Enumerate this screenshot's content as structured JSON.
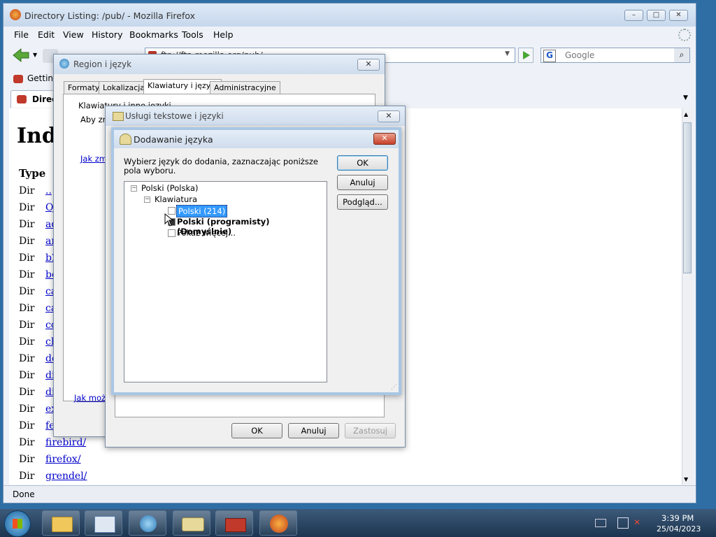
{
  "firefox": {
    "title": "Directory Listing: /pub/ - Mozilla Firefox",
    "menu": [
      "File",
      "Edit",
      "View",
      "History",
      "Bookmarks",
      "Tools",
      "Help"
    ],
    "url": "ftp://ftp.mozilla.org/pub/",
    "search_placeholder": "Google",
    "bookmark": "Getting Started",
    "tab": "Directory Listing: /pub/",
    "heading": "Index of /pub/",
    "column_type": "Type",
    "rows": [
      {
        "type": "Dir",
        "name": ".."
      },
      {
        "type": "Dir",
        "name": "OJI/"
      },
      {
        "type": "Dir",
        "name": "addons/"
      },
      {
        "type": "Dir",
        "name": "artwork/"
      },
      {
        "type": "Dir",
        "name": "b2g/"
      },
      {
        "type": "Dir",
        "name": "bouncer/"
      },
      {
        "type": "Dir",
        "name": "calendar/"
      },
      {
        "type": "Dir",
        "name": "camino/"
      },
      {
        "type": "Dir",
        "name": "composer/"
      },
      {
        "type": "Dir",
        "name": "chat/"
      },
      {
        "type": "Dir",
        "name": "devpreview/"
      },
      {
        "type": "Dir",
        "name": "directory/"
      },
      {
        "type": "Dir",
        "name": "dist/"
      },
      {
        "type": "Dir",
        "name": "extensions/"
      },
      {
        "type": "Dir",
        "name": "fenix/"
      },
      {
        "type": "Dir",
        "name": "firebird/"
      },
      {
        "type": "Dir",
        "name": "firefox/"
      },
      {
        "type": "Dir",
        "name": "grendel/"
      }
    ],
    "status": "Done"
  },
  "region_dialog": {
    "title": "Region i język",
    "tabs": [
      "Formaty",
      "Lokalizacja",
      "Klawiatury i języki",
      "Administracyjne"
    ],
    "group_label": "Klawiatury i inne języki",
    "text": "Aby zmienić",
    "link1": "Jak zmienić",
    "link2": "Jak można"
  },
  "text_services_dialog": {
    "title": "Usługi tekstowe i języki",
    "ok": "OK",
    "cancel": "Anuluj",
    "apply": "Zastosuj"
  },
  "add_language_dialog": {
    "title": "Dodawanie języka",
    "instruction": "Wybierz język do dodania, zaznaczając poniższe pola wyboru.",
    "ok": "OK",
    "cancel": "Anuluj",
    "preview": "Podgląd...",
    "tree": {
      "root": "Polski (Polska)",
      "group": "Klawiatura",
      "items": [
        {
          "label": "Polski (214)",
          "selected": true
        },
        {
          "label": "Polski (programisty) (Domyślnie)",
          "bold": true
        },
        {
          "label": "Pokaż więcej..."
        }
      ]
    }
  },
  "taskbar": {
    "time": "3:39 PM",
    "date": "25/04/2023"
  }
}
